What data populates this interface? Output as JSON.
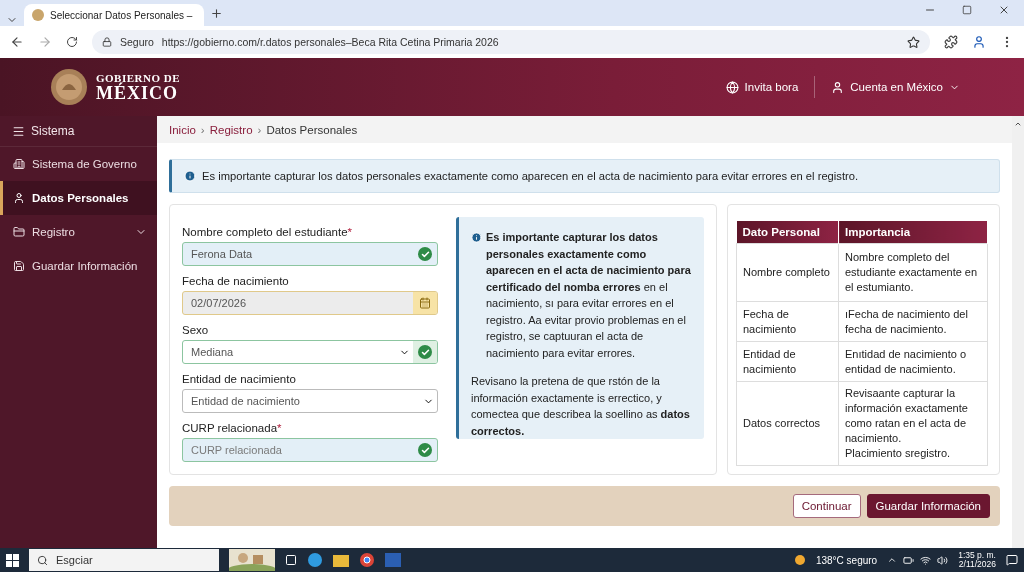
{
  "browser": {
    "tab_title": "Seleccionar Datos Personales –",
    "security": "Seguro",
    "url": "https://gobierno.com/r.datos personales–Beca Rita Cetina Primaria 2026"
  },
  "header": {
    "logo_line1": "GOBIERNO DE",
    "logo_line2": "MÉXICO",
    "links": [
      {
        "kind": "globe",
        "label": "Invita bora"
      },
      {
        "kind": "user",
        "label": "Cuenta en México"
      }
    ]
  },
  "sidebar": {
    "title": "Sistema",
    "items": [
      {
        "kind": "building",
        "label": "Sistema de Governo",
        "selected": false
      },
      {
        "kind": "user",
        "label": "Datos Personales",
        "selected": true
      },
      {
        "kind": "folder",
        "label": "Registro",
        "selected": false,
        "expanded": false
      },
      {
        "kind": "save",
        "label": "Guardar Información",
        "selected": false
      }
    ]
  },
  "breadcrumb": [
    {
      "label": "Inicio"
    },
    {
      "separator": "›",
      "label": "Registro"
    },
    {
      "separator": "›",
      "label": "Datos Personales"
    }
  ],
  "alert": "Es importante capturar los datos personales exactamente como aparecen en el acta de nacimiento para evitar errores en el registro.",
  "form": {
    "fields": [
      {
        "kind": "text",
        "label": "Nombre completo del estudiante",
        "required_mark": "*",
        "value": "Ferona Data",
        "valid": true
      },
      {
        "kind": "date",
        "label": "Fecha de nacimiento",
        "value": "02/07/2026",
        "valid": false
      },
      {
        "kind": "select",
        "label": "Sexo",
        "value": "Mediana",
        "valid": true
      },
      {
        "kind": "select",
        "label": "Entidad de nacimiento",
        "value": "Entidad de nacimiento",
        "valid": false
      },
      {
        "kind": "text",
        "label": "CURP relacionada",
        "required_mark": "*",
        "placeholder": "CURP relacionada",
        "valid": true
      }
    ]
  },
  "note": {
    "paragraphs": [
      "**Es importante capturar los datos personales exactamente como aparecen en el acta de nacimiento para certificado del nomba errores** en el nacimiento, sı para evitar errores en el registro. Aa evitar provio problemas en el registro, se captuuran el acta de nacimiento para evitar errores.",
      "Revisano la pretena de que rstón de la información exactamente is errectico, y comectea que describea la soellino as **datos correctos.**"
    ]
  },
  "table": {
    "columns": [
      "Dato Personal",
      "Importancia"
    ],
    "rows": [
      [
        "Nombre completo",
        "Nombre completo del estudiante exactamente en el estumianto."
      ],
      [
        "Fecha de nacimiento",
        "ıFecha de nacimiento del fecha de nacimiento."
      ],
      [
        "Entidad de nacimiento",
        "Enıtidad de nacimiento o entidad de nacimiento."
      ],
      [
        "Datos correctos",
        "Revisaante capturar la información exactamente como ratan en el acta de nacimiento.\nPlacimiento sregistro."
      ]
    ]
  },
  "buttons": [
    {
      "kind": "secondary",
      "label": "Continuar"
    },
    {
      "kind": "primary",
      "label": "Guardar Información"
    }
  ],
  "taskbar": {
    "search": "Esgciar",
    "weather": "138°C seguro",
    "time": "1:35 p. m.",
    "date": "2/11/2026"
  }
}
